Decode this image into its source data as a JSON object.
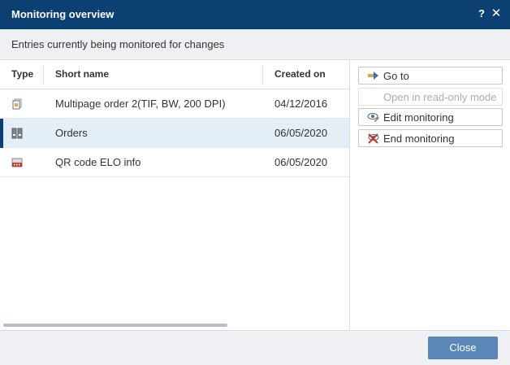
{
  "window": {
    "title": "Monitoring overview",
    "help_label": "?",
    "close_label": "✕"
  },
  "subtitle": "Entries currently being monitored for changes",
  "table": {
    "columns": {
      "type": "Type",
      "short_name": "Short name",
      "created_on": "Created on"
    },
    "rows": [
      {
        "icon": "multipage-document-icon",
        "short_name": "Multipage order 2(TIF, BW, 200 DPI)",
        "created_on": "04/12/2016",
        "selected": false
      },
      {
        "icon": "folder-binders-icon",
        "short_name": "Orders",
        "created_on": "06/05/2020",
        "selected": true
      },
      {
        "icon": "png-file-icon",
        "short_name": "QR code ELO info",
        "created_on": "06/05/2020",
        "selected": false
      }
    ]
  },
  "actions": {
    "go_to": "Go to",
    "open_read_only": "Open in read-only mode",
    "edit_monitoring": "Edit monitoring",
    "end_monitoring": "End monitoring"
  },
  "footer": {
    "close_label": "Close"
  },
  "colors": {
    "titlebar": "#0c3f72",
    "selection": "#e4eef6",
    "primary_button": "#5b87b8"
  }
}
